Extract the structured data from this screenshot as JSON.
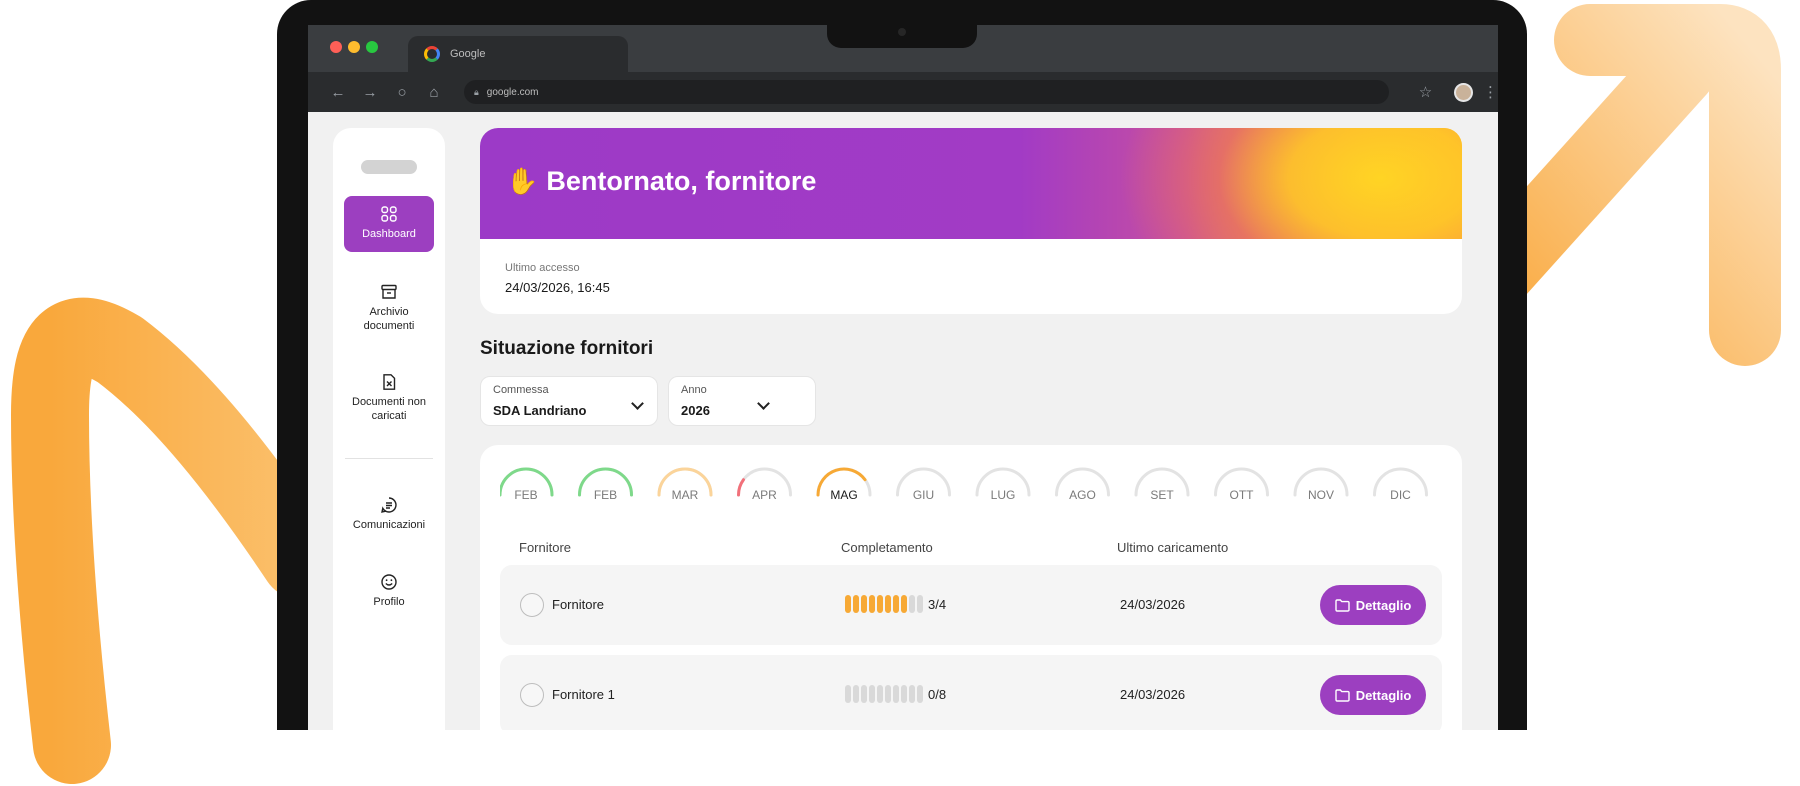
{
  "browser": {
    "tab_title": "Google",
    "url": "google.com",
    "dot_colors": [
      "#ff5f57",
      "#febc2e",
      "#28c840"
    ]
  },
  "sidebar": {
    "items": [
      {
        "label": "Dashboard",
        "icon": "grid-icon",
        "active": true
      },
      {
        "label": "Archivio documenti",
        "icon": "archive-box-icon",
        "active": false
      },
      {
        "label": "Documenti non caricati",
        "icon": "file-x-icon",
        "active": false
      },
      {
        "label": "Comunicazioni",
        "icon": "chat-lines-icon",
        "active": false
      },
      {
        "label": "Profilo",
        "icon": "smile-icon",
        "active": false
      }
    ]
  },
  "hero": {
    "title": "Bentornato, fornitore",
    "icon": "waving-hand-icon",
    "last_access_label": "Ultimo accesso",
    "last_access_value": "24/03/2026, 16:45"
  },
  "section": {
    "title": "Situazione fornitori"
  },
  "filters": {
    "commessa_label": "Commessa",
    "commessa_value": "SDA Landriano",
    "anno_label": "Anno",
    "anno_value": "2026"
  },
  "months": [
    {
      "label": "FEB",
      "fill": 1.0,
      "color": "#7ed98a"
    },
    {
      "label": "FEB",
      "fill": 1.0,
      "color": "#7ed98a"
    },
    {
      "label": "MAR",
      "fill": 1.0,
      "color": "#fbd49a"
    },
    {
      "label": "APR",
      "fill": 0.2,
      "color": "#f2707a"
    },
    {
      "label": "MAG",
      "fill": 0.8,
      "color": "#f7a935",
      "bold": true
    },
    {
      "label": "GIU",
      "fill": 0,
      "color": "#e3e3e3"
    },
    {
      "label": "LUG",
      "fill": 0,
      "color": "#e3e3e3"
    },
    {
      "label": "AGO",
      "fill": 0,
      "color": "#e3e3e3"
    },
    {
      "label": "SET",
      "fill": 0,
      "color": "#e3e3e3"
    },
    {
      "label": "OTT",
      "fill": 0,
      "color": "#e3e3e3"
    },
    {
      "label": "NOV",
      "fill": 0,
      "color": "#e3e3e3"
    },
    {
      "label": "DIC",
      "fill": 0,
      "color": "#e3e3e3"
    }
  ],
  "table": {
    "headers": [
      "Fornitore",
      "Completamento",
      "Ultimo caricamento"
    ],
    "rows": [
      {
        "name": "Fornitore",
        "done": 3,
        "total": 4,
        "progress_text": "3/4",
        "date": "24/03/2026",
        "button": "Dettaglio"
      },
      {
        "name": "Fornitore 1",
        "done": 0,
        "total": 8,
        "progress_text": "0/8",
        "date": "24/03/2026",
        "button": "Dettaglio"
      }
    ]
  },
  "colors": {
    "accent": "#9c3fc0",
    "orange": "#f7a935"
  }
}
